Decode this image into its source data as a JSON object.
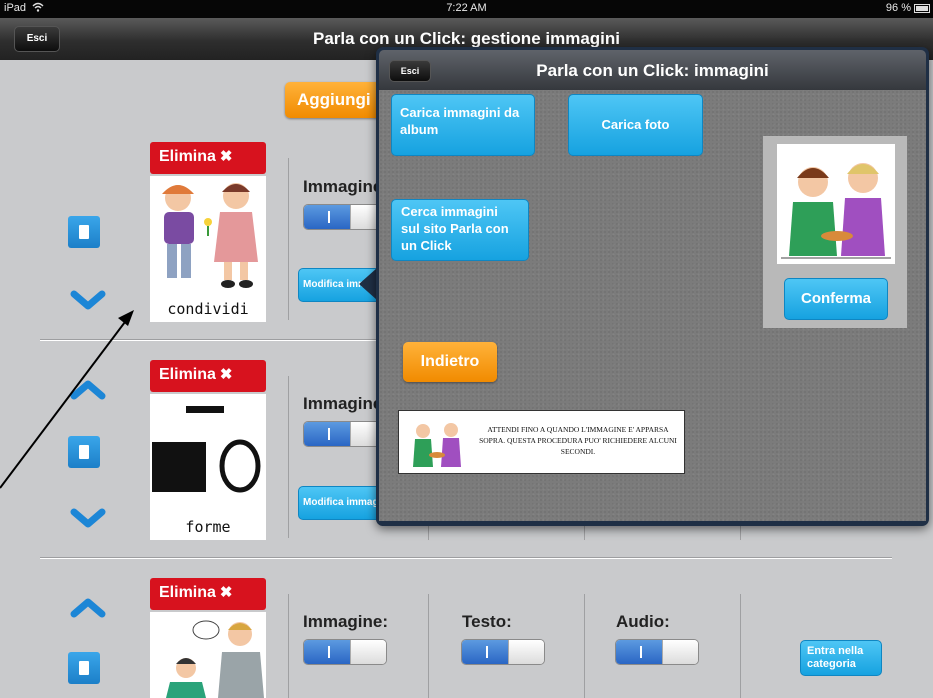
{
  "status_bar": {
    "device": "iPad",
    "time": "7:22 AM",
    "battery": "96 %"
  },
  "nav": {
    "exit_label": "Esci",
    "title": "Parla con un Click: gestione immagini"
  },
  "add_button": "Aggiungi",
  "items": [
    {
      "delete_label": "Elimina",
      "caption": "condividi",
      "image_label": "Immagine:",
      "edit_label": "Modifica immagine"
    },
    {
      "delete_label": "Elimina",
      "caption": "forme",
      "image_label": "Immagine:",
      "edit_label": "Modifica immagine"
    },
    {
      "delete_label": "Elimina",
      "image_label": "Immagine:",
      "text_label": "Testo:",
      "audio_label": "Audio:",
      "category_button": "Entra nella categoria"
    }
  ],
  "popover": {
    "exit_label": "Esci",
    "title": "Parla con un Click: immagini",
    "load_album": "Carica immagini da album",
    "load_photo": "Carica foto",
    "search_site": "Cerca immagini sul sito Parla con un Click",
    "confirm": "Conferma",
    "back": "Indietro",
    "notice": "ATTENDI FINO A QUANDO L'IMMAGINE E' APPARSA SOPRA. QUESTA PROCEDURA PUO' RICHIEDERE ALCUNI SECONDI."
  },
  "colors": {
    "accent_blue": "#1ea6e6",
    "delete_red": "#d7121e",
    "orange": "#f39a12",
    "toggle_on": "#3b7fd4"
  },
  "icons": [
    "wifi-icon",
    "battery-icon",
    "chevron-up-icon",
    "chevron-down-icon",
    "document-icon",
    "close-x-icon"
  ]
}
